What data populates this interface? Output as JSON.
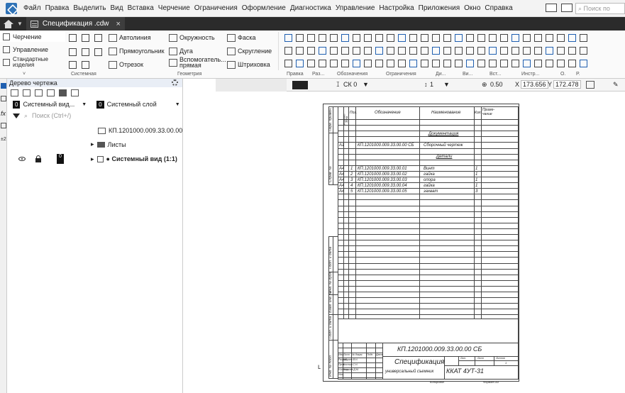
{
  "menu": [
    "Файл",
    "Правка",
    "Выделить",
    "Вид",
    "Вставка",
    "Черчение",
    "Ограничения",
    "Оформление",
    "Диагностика",
    "Управление",
    "Настройка",
    "Приложения",
    "Окно",
    "Справка"
  ],
  "search_placeholder": "Поиск по",
  "tab": {
    "label": "Спецификация .cdw",
    "close": "×"
  },
  "ribbon": {
    "left_items": [
      "Черчение",
      "Управление",
      "Стандартные изделия"
    ],
    "tools": {
      "autoline": "Автолиния",
      "rectangle": "Прямоугольник",
      "segment": "Отрезок",
      "circle": "Окружность",
      "arc": "Дуга",
      "aux_line": "Вспомогатель...\nпрямая",
      "chamfer": "Фаска",
      "fillet": "Скругление",
      "hatch": "Штриховка"
    },
    "groups": [
      "Системная",
      "Геометрия",
      "Правка",
      "Раз...",
      "Обозначения",
      "Ограничения",
      "Ди...",
      "Ви...",
      "Вст...",
      "Инстр...",
      "О.",
      "Р."
    ]
  },
  "doc_toolbar": {
    "layer": "СК 0",
    "step": "1",
    "zoom": "0.50",
    "x_label": "X",
    "x": "173.656",
    "y_label": "Y",
    "y": "172.478"
  },
  "tree": {
    "title": "Дерево чертежа",
    "view_select": {
      "num": "0",
      "label": "Системный вид..."
    },
    "layer_select": {
      "num": "0",
      "label": "Системный слой"
    },
    "search_placeholder": "Поиск (Ctrl+/)",
    "root": "КП.1201000.009.33.00.00 С",
    "sheets": "Листы",
    "view_num": "0",
    "view": "● Системный вид (1:1)"
  },
  "spec": {
    "headers": {
      "format": "Формат",
      "zone": "Зона",
      "pos": "Поз.",
      "designation": "Обозначение",
      "name": "Наименование",
      "qty": "Кол.",
      "note": "Приме-\nчание"
    },
    "sections": {
      "docs": "Документация",
      "parts": "Детали"
    },
    "assembly": {
      "format": "А1",
      "designation": "КП.1201000.009.33.00.00 СБ",
      "name": "Сборочный чертеж"
    },
    "parts": [
      {
        "format": "А4",
        "pos": "1",
        "designation": "КП.1201000.009.33.00.01",
        "name": "Винт",
        "qty": "1"
      },
      {
        "format": "А4",
        "pos": "2",
        "designation": "КП.1201000.009.33.00.02",
        "name": "гайка",
        "qty": "1"
      },
      {
        "format": "А4",
        "pos": "3",
        "designation": "КП.1201000.009.33.00.03",
        "name": "опора",
        "qty": "1"
      },
      {
        "format": "А4",
        "pos": "4",
        "designation": "КП.1201000.009.33.00.04",
        "name": "гайка",
        "qty": "1"
      },
      {
        "format": "А4",
        "pos": "5",
        "designation": "КП.1201000.009.33.00.05",
        "name": "захват",
        "qty": "3"
      }
    ],
    "stamp": {
      "code": "КП.1201000.009.33.00.00 СБ",
      "title": "Спецификация",
      "subtitle": "универсальный съемник",
      "org": "ККАТ 4УТ-31",
      "cols": [
        "Изм.",
        "Лист",
        "№ докум.",
        "Подп.",
        "Дата"
      ],
      "rows": [
        "Разраб.",
        "Пров.",
        "Н.контр.",
        "Утв."
      ],
      "people": [
        "Ширяев В.Н.",
        "Костин С.Н.",
        "Ковалев Д.М."
      ],
      "lit": "Лит.",
      "sheet": "Лист",
      "sheets": "Листов",
      "sheets_val": "1",
      "copied": "Копировал",
      "format": "Формат   А4"
    },
    "side_labels": [
      "Перв. примен.",
      "Справ. №",
      "Подп. и дата",
      "Инв. № дубл.",
      "Взам. инв. №",
      "Подп. и дата",
      "Инв. № подл."
    ]
  }
}
